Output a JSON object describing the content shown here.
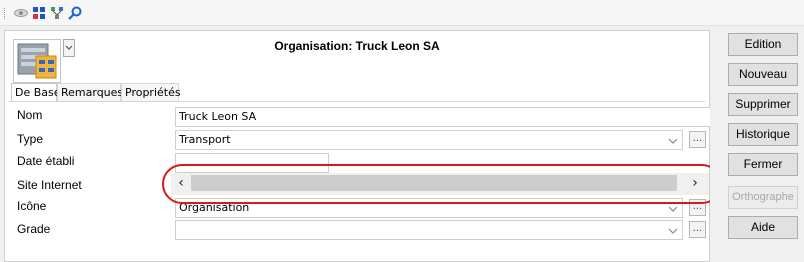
{
  "toolbar": {
    "icons": [
      "eye-icon",
      "grid-icon",
      "connect-icon",
      "search-icon"
    ]
  },
  "title": "Organisation: Truck Leon SA",
  "tabs": [
    {
      "label": "De Base",
      "active": true
    },
    {
      "label": "Remarques",
      "active": false
    },
    {
      "label": "Propriétés",
      "active": false
    }
  ],
  "fields": {
    "nom": {
      "label": "Nom",
      "value": "Truck Leon SA"
    },
    "type": {
      "label": "Type",
      "value": "Transport"
    },
    "date": {
      "label": "Date établi",
      "value": ""
    },
    "site": {
      "label": "Site Internet",
      "value": ""
    },
    "icone": {
      "label": "Icône",
      "value": "Organisation"
    },
    "grade": {
      "label": "Grade",
      "value": ""
    }
  },
  "scrollbar": {
    "left": "‹",
    "right": "›"
  },
  "buttons": {
    "edition": "Edition",
    "nouveau": "Nouveau",
    "supprimer": "Supprimer",
    "historique": "Historique",
    "fermer": "Fermer",
    "orthographe": "Orthographe",
    "aide": "Aide"
  },
  "browse_label": "...",
  "colors": {
    "highlight_ring": "#d51c1c"
  }
}
